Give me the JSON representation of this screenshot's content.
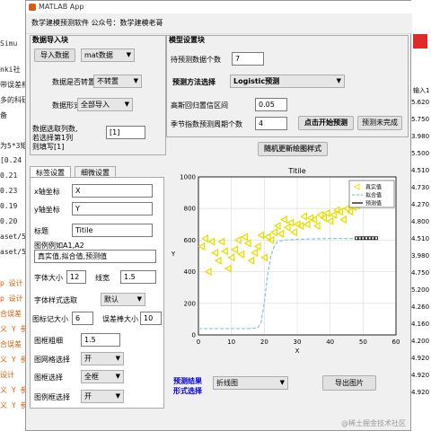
{
  "background": {
    "sim_label": "Simu",
    "sim_label2": "SIMU",
    "code_lines": [
      "nki社",
      "带误差相",
      "多的科研",
      "备",
      "",
      "为5*3矩",
      "[0.24",
      "0.21",
      "0.23",
      "0.19",
      "0.20",
      "aset/5",
      "aset/5",
      "",
      "p 设计",
      "p 设计",
      "合误差",
      "义 Y 参",
      "合误差",
      "义 Y 参",
      "设计",
      "义 Y 参数",
      "义 Y 参数的虚部已忽略。"
    ],
    "right_header": "输入1",
    "right_values": [
      "5.620",
      "5.750",
      "3.980",
      "5.500",
      "4.510",
      "4.730",
      "4.270",
      "4.800",
      "4.510",
      "3.980",
      "4.750",
      "5.200",
      "4.260",
      "4.160",
      "4.200",
      "4.920",
      "4.920",
      "4.920"
    ],
    "footer": "@稀土掘金技术社区"
  },
  "window": {
    "app_title": "MATLAB App",
    "menu_title": "数学建模预测软件 公众号：数学建模老哥"
  },
  "data_import": {
    "panel_title": "数据导入块",
    "import_button": "导入数据",
    "format_value": "mat数据",
    "transpose_label": "数据是否转置",
    "transpose_value": "不转置",
    "form_label": "数据形式",
    "form_value": "全部导入",
    "select_label_1": "数据选取列数,",
    "select_label_2": "若选择第1列",
    "select_label_3": "则填写[1]",
    "select_value": "[1]"
  },
  "model": {
    "panel_title": "模型设置块",
    "count_label": "待预测数据个数",
    "count_value": "7",
    "method_label": "预测方法选择",
    "method_value": "Logistic预测",
    "confidence_label": "高斯回归置信区间",
    "confidence_value": "0.05",
    "season_label": "季节指数预测周期个数",
    "season_value": "4",
    "predict_button": "点击开始预测",
    "status_text": "预测未完成"
  },
  "tabs": {
    "tab1": "标签设置",
    "tab2": "细微设置",
    "update_button": "随机更新绘图样式"
  },
  "labels": {
    "x_label": "x轴坐标",
    "x_value": "X",
    "y_label": "y轴坐标",
    "y_value": "Y",
    "title_label": "标题",
    "title_value": "Titile",
    "legend_label": "图例例如A1,A2",
    "legend_value": "真实值,拟合值,预测值",
    "font_size_label": "字体大小",
    "font_size_value": "12",
    "line_width_label": "线宽",
    "line_width_value": "1.5",
    "font_style_label": "字体样式选取",
    "font_style_value": "默认",
    "marker_label": "图标记大小",
    "marker_value": "6",
    "errorbar_label": "误差棒大小",
    "errorbar_value": "10",
    "frame_width_label": "图框粗细",
    "frame_width_value": "1.5",
    "grid_label": "图网格选择",
    "grid_value": "开",
    "frame_label": "图框选择",
    "frame_value": "全框",
    "legend_sel_label": "图例框选择",
    "legend_sel_value": "开"
  },
  "bottom": {
    "result_label_1": "预测结果",
    "result_label_2": "形式选择",
    "result_value": "折线图",
    "export_button": "导出图片"
  },
  "chart_data": {
    "type": "line",
    "title": "Titile",
    "xlabel": "X",
    "ylabel": "Y",
    "xlim": [
      0,
      60
    ],
    "ylim": [
      0,
      1000
    ],
    "xticks": [
      0,
      10,
      20,
      30,
      40,
      50,
      60
    ],
    "yticks": [
      0,
      200,
      400,
      600,
      800,
      1000
    ],
    "grid": true,
    "legend_position": "top-right",
    "series": [
      {
        "name": "真实值",
        "style": "triangle-markers",
        "color": "#e8e000",
        "points": [
          [
            1,
            560
          ],
          [
            2,
            610
          ],
          [
            3,
            400
          ],
          [
            4,
            590
          ],
          [
            5,
            520
          ],
          [
            6,
            470
          ],
          [
            7,
            590
          ],
          [
            8,
            530
          ],
          [
            9,
            420
          ],
          [
            10,
            490
          ],
          [
            11,
            540
          ],
          [
            12,
            600
          ],
          [
            13,
            510
          ],
          [
            14,
            620
          ],
          [
            15,
            580
          ],
          [
            16,
            470
          ],
          [
            17,
            520
          ],
          [
            18,
            560
          ],
          [
            19,
            630
          ],
          [
            20,
            490
          ],
          [
            21,
            620
          ],
          [
            22,
            600
          ],
          [
            23,
            650
          ],
          [
            24,
            690
          ],
          [
            25,
            640
          ],
          [
            26,
            730
          ],
          [
            27,
            680
          ],
          [
            28,
            710
          ],
          [
            29,
            650
          ],
          [
            30,
            700
          ],
          [
            31,
            690
          ],
          [
            32,
            750
          ],
          [
            33,
            700
          ],
          [
            34,
            740
          ],
          [
            35,
            730
          ],
          [
            36,
            690
          ],
          [
            37,
            760
          ],
          [
            38,
            740
          ],
          [
            39,
            770
          ],
          [
            40,
            720
          ],
          [
            41,
            760
          ],
          [
            42,
            790
          ],
          [
            43,
            780
          ],
          [
            44,
            730
          ],
          [
            45,
            800
          ],
          [
            46,
            780
          ],
          [
            47,
            810
          ],
          [
            48,
            820
          ]
        ]
      },
      {
        "name": "拟合值",
        "style": "dashed",
        "color": "#7ec8e3",
        "points": [
          [
            0,
            40
          ],
          [
            10,
            40
          ],
          [
            15,
            40
          ],
          [
            18,
            45
          ],
          [
            19,
            80
          ],
          [
            20,
            200
          ],
          [
            21,
            380
          ],
          [
            22,
            500
          ],
          [
            23,
            560
          ],
          [
            24,
            590
          ],
          [
            26,
            600
          ],
          [
            30,
            605
          ],
          [
            40,
            610
          ],
          [
            48,
            610
          ]
        ]
      },
      {
        "name": "预测值",
        "style": "line-markers",
        "color": "#000000",
        "points": [
          [
            48,
            612
          ],
          [
            49,
            612
          ],
          [
            50,
            612
          ],
          [
            51,
            612
          ],
          [
            52,
            612
          ],
          [
            53,
            612
          ],
          [
            54,
            612
          ]
        ]
      }
    ]
  }
}
